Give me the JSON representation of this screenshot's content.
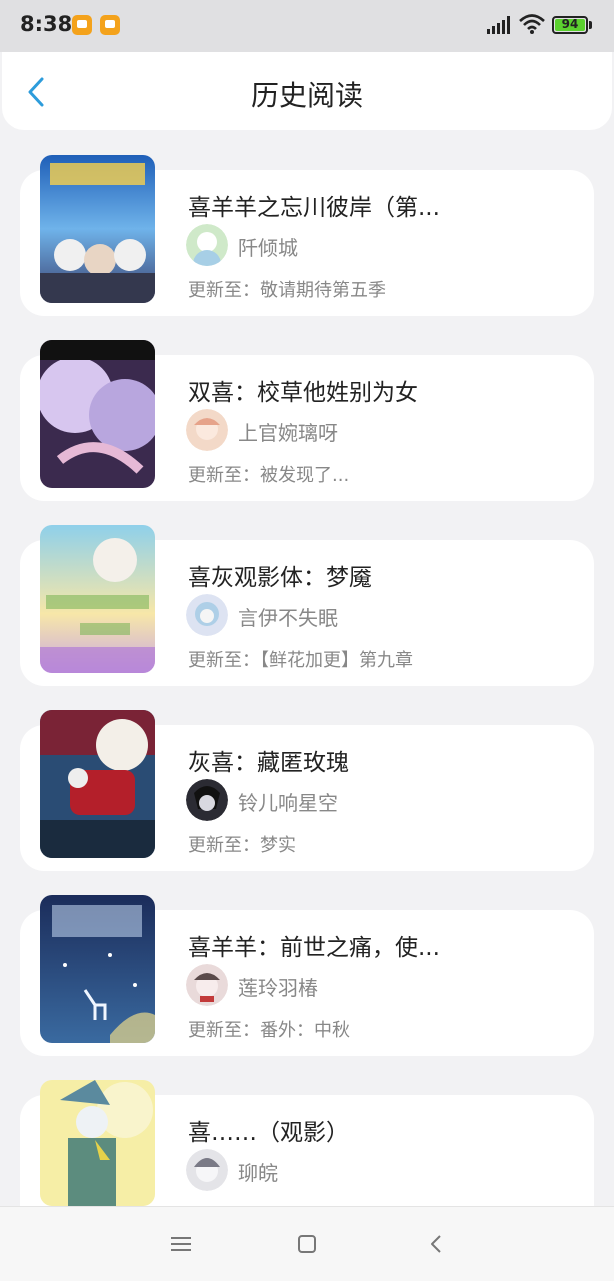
{
  "status_bar": {
    "time": "8:38",
    "battery": "94",
    "notification_icons": [
      "app-notification-icon",
      "app-notification-icon"
    ]
  },
  "header": {
    "title": "历史阅读",
    "back_icon": "chevron-left-icon"
  },
  "history": [
    {
      "title": "喜羊羊之忘川彼岸（第...",
      "author": "阡倾城",
      "update": "更新至：敬请期待第五季"
    },
    {
      "title": "双喜：校草他姓别为女",
      "author": "上官婉璃呀",
      "update": "更新至：被发现了..."
    },
    {
      "title": "喜灰观影体：梦魇",
      "author": "言伊不失眠",
      "update": "更新至：【鲜花加更】第九章"
    },
    {
      "title": "灰喜：藏匿玫瑰",
      "author": "铃儿响星空",
      "update": "更新至：梦实"
    },
    {
      "title": "喜羊羊：前世之痛，使...",
      "author": "莲玲羽椿",
      "update": "更新至：番外：中秋"
    },
    {
      "title": "喜……（观影）",
      "author": "珋皖",
      "update": ""
    }
  ],
  "colors": {
    "accent": "#2d9cdb",
    "background": "#f2f2f4",
    "card": "#ffffff",
    "text_primary": "#222222",
    "text_secondary": "#888888"
  },
  "navbar": {
    "icons": [
      "menu-icon",
      "home-square-icon",
      "back-triangle-icon"
    ]
  }
}
